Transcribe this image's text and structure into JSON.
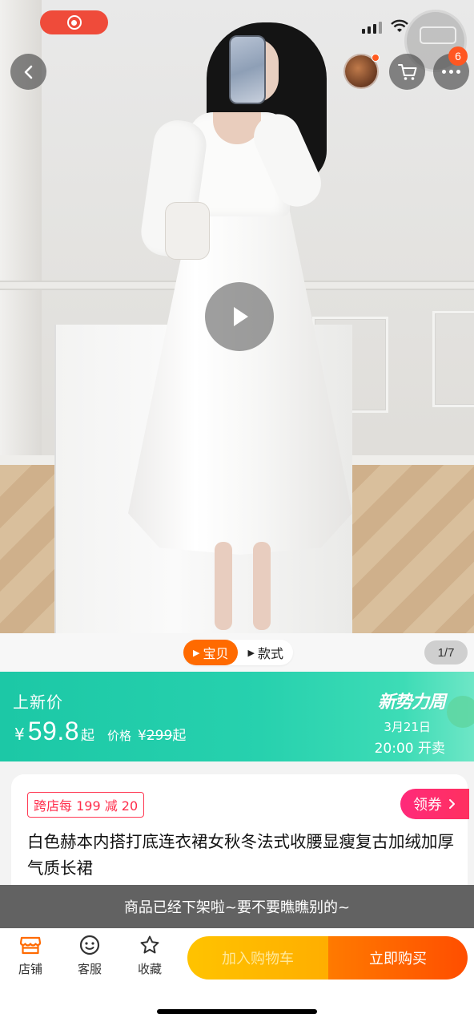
{
  "top_bar": {
    "cart_badge": "6"
  },
  "media": {
    "tabs": [
      {
        "label": "宝贝",
        "active": true
      },
      {
        "label": "款式",
        "active": false
      }
    ],
    "pager": "1/7"
  },
  "price_banner": {
    "label": "上新价",
    "currency": "¥",
    "price": "59.8",
    "price_suffix": "起",
    "orig_label": "价格",
    "orig_currency": "¥",
    "orig_price": "299",
    "orig_suffix": "起",
    "event_logo": "新势力周",
    "event_date": "3月21日",
    "event_time": "20:00 开卖"
  },
  "product": {
    "promo_tag": "跨店每 199 减 20",
    "coupon_label": "领券",
    "title": "白色赫本内搭打底连衣裙女秋冬法式收腰显瘦复古加绒加厚气质长裙"
  },
  "toast": "商品已经下架啦~要不要瞧瞧别的~",
  "action_bar": {
    "store_label": "店铺",
    "service_label": "客服",
    "favorite_label": "收藏",
    "add_to_cart_label": "加入购物车",
    "buy_now_label": "立即购买"
  },
  "colors": {
    "accent_orange": "#ff6a00",
    "banner_teal": "#27d1ae",
    "coupon_pink": "#ff2d6b",
    "promo_red": "#ff2d4b"
  },
  "icons": [
    "record-icon",
    "back-arrow-icon",
    "cart-icon",
    "more-dots-icon",
    "play-icon",
    "store-icon",
    "service-icon",
    "star-icon",
    "chevron-right-icon"
  ]
}
